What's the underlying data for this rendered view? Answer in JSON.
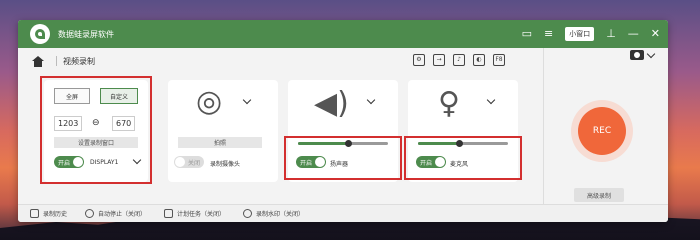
{
  "app": {
    "title": "数据蛙录屏软件",
    "mini_window": "小窗口"
  },
  "toolbar": {
    "breadcrumb": "视频录制",
    "icons": [
      "settings-icon",
      "export-icon",
      "speaker-icon",
      "mouse-icon",
      "f8-key-icon"
    ]
  },
  "screen_panel": {
    "fullscreen_label": "全屏",
    "custom_label": "自定义",
    "width": "1203",
    "height": "670",
    "set_window_label": "设置录制窗口",
    "toggle_label": "开启",
    "display_label": "DISPLAY1"
  },
  "camera_panel": {
    "photo_label": "拍照",
    "toggle_label": "关闭",
    "device_label": "录制摄像头"
  },
  "speaker_panel": {
    "toggle_label": "开启",
    "device_label": "扬声器",
    "volume": 0.55
  },
  "mic_panel": {
    "toggle_label": "开启",
    "device_label": "麦克风",
    "volume": 0.45
  },
  "rec": {
    "label": "REC",
    "advanced_label": "高级录制"
  },
  "bottom": {
    "history": "录制历史",
    "autostop": "自动停止（关闭）",
    "schedule": "计划任务（关闭）",
    "watermark": "录制水印（关闭）"
  },
  "colors": {
    "titlebar": "#4d8b4d",
    "rec": "#f0673a",
    "highlight": "#d32f2f"
  }
}
